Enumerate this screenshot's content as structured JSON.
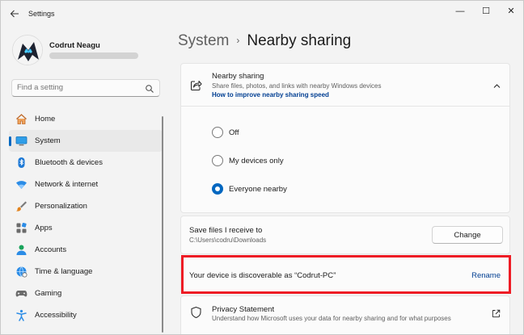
{
  "app": {
    "title": "Settings"
  },
  "window_controls": {
    "minimize": "—",
    "maximize": "☐",
    "close": "✕"
  },
  "user": {
    "name": "Codrut Neagu"
  },
  "search": {
    "placeholder": "Find a setting"
  },
  "sidebar": {
    "items": [
      {
        "label": "Home",
        "icon": "home-icon",
        "selected": false
      },
      {
        "label": "System",
        "icon": "system-icon",
        "selected": true
      },
      {
        "label": "Bluetooth & devices",
        "icon": "bluetooth-icon",
        "selected": false
      },
      {
        "label": "Network & internet",
        "icon": "wifi-icon",
        "selected": false
      },
      {
        "label": "Personalization",
        "icon": "brush-icon",
        "selected": false
      },
      {
        "label": "Apps",
        "icon": "apps-icon",
        "selected": false
      },
      {
        "label": "Accounts",
        "icon": "account-icon",
        "selected": false
      },
      {
        "label": "Time & language",
        "icon": "globe-icon",
        "selected": false
      },
      {
        "label": "Gaming",
        "icon": "gamepad-icon",
        "selected": false
      },
      {
        "label": "Accessibility",
        "icon": "accessibility-icon",
        "selected": false
      }
    ]
  },
  "breadcrumb": {
    "parent": "System",
    "separator": "›",
    "current": "Nearby sharing"
  },
  "nearby_sharing": {
    "title": "Nearby sharing",
    "description": "Share files, photos, and links with nearby Windows devices",
    "link": "How to improve nearby sharing speed",
    "options": [
      {
        "label": "Off",
        "checked": false
      },
      {
        "label": "My devices only",
        "checked": false
      },
      {
        "label": "Everyone nearby",
        "checked": true
      }
    ]
  },
  "save_files": {
    "title": "Save files I receive to",
    "path": "C:\\Users\\codru\\Downloads",
    "button": "Change"
  },
  "discoverable": {
    "text": "Your device is discoverable as “Codrut-PC”",
    "action": "Rename"
  },
  "privacy": {
    "title": "Privacy Statement",
    "description": "Understand how Microsoft uses your data for nearby sharing and for what purposes"
  },
  "colors": {
    "accent": "#0067c0",
    "highlight": "#ee1c25"
  }
}
